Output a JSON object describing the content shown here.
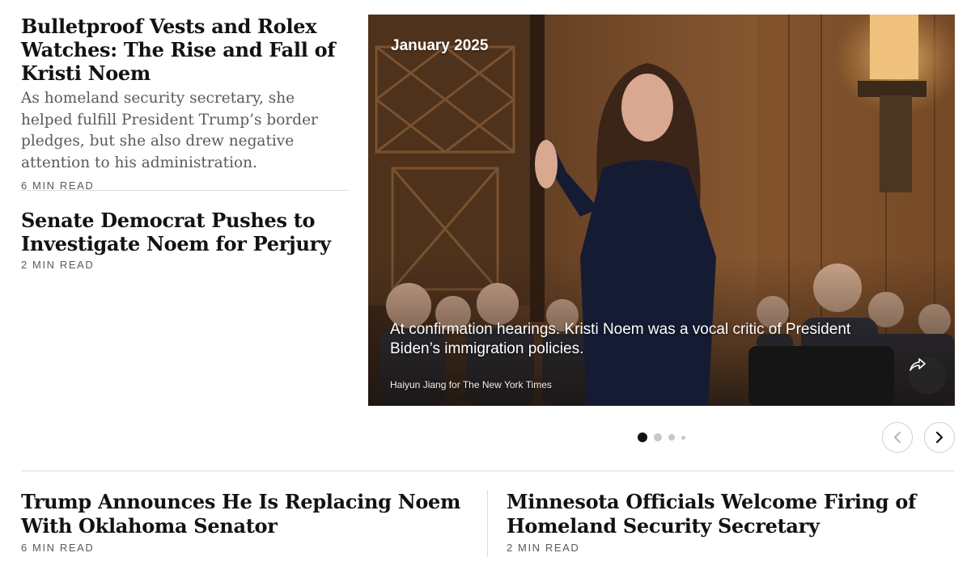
{
  "lead_story": {
    "headline": "Bulletproof Vests and Rolex Watches: The Rise and Fall of Kristi Noem",
    "summary": "As homeland security secretary, she helped fulfill President Trump’s border pledges, but she also drew negative attention to his administration.",
    "read_time": "6 MIN READ"
  },
  "second_story": {
    "headline": "Senate Democrat Pushes to Investigate Noem for Perjury",
    "read_time": "2 MIN READ"
  },
  "slideshow": {
    "date_label": "January 2025",
    "caption": "At confirmation hearings. Kristi Noem was a vocal critic of President Biden’s immigration policies.",
    "credit": "Haiyun Jiang for The New York Times",
    "share_icon": "share-arrow-icon",
    "total_slides": 4,
    "active_slide": 1,
    "prev_icon": "chevron-left-icon",
    "next_icon": "chevron-right-icon"
  },
  "bottom_stories": [
    {
      "headline": "Trump Announces He Is Replacing Noem With Oklahoma Senator",
      "read_time": "6 MIN READ"
    },
    {
      "headline": "Minnesota Officials Welcome Firing of Homeland Security Secretary",
      "read_time": "2 MIN READ"
    }
  ],
  "colors": {
    "text": "#121212",
    "secondary_text": "#5a5a5a",
    "divider": "#dcdcdc",
    "active_dot": "#121212",
    "inactive_dot": "#c7c7c7"
  }
}
